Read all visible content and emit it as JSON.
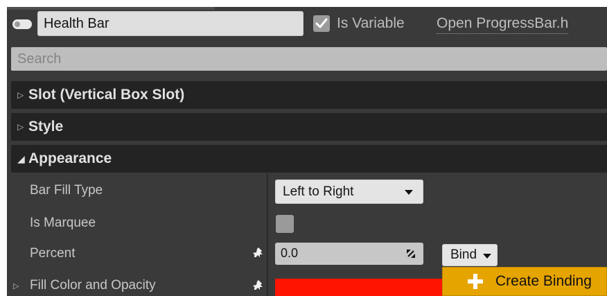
{
  "header": {
    "widget_name": "Health Bar",
    "is_variable_label": "Is Variable",
    "is_variable_checked": true,
    "open_source_link": "Open ProgressBar.h"
  },
  "search": {
    "placeholder": "Search",
    "value": ""
  },
  "categories": [
    {
      "label": "Slot (Vertical Box Slot)",
      "expanded": false
    },
    {
      "label": "Style",
      "expanded": false
    },
    {
      "label": "Appearance",
      "expanded": true
    }
  ],
  "appearance": {
    "bar_fill_type": {
      "label": "Bar Fill Type",
      "value": "Left to Right"
    },
    "is_marquee": {
      "label": "Is Marquee",
      "checked": false
    },
    "percent": {
      "label": "Percent",
      "value": "0.0",
      "bind_label": "Bind"
    },
    "fill_color": {
      "label": "Fill Color and Opacity",
      "color": "#ff1400"
    }
  },
  "bind_menu": {
    "create_binding_label": "Create Binding",
    "accent": "#e6a400"
  },
  "icons": [
    "widget-toggle-icon",
    "checkmark-icon",
    "expand-arrow-icon",
    "collapse-arrow-icon",
    "binding-pin-icon",
    "resize-icon",
    "dropdown-caret-icon",
    "plus-icon"
  ],
  "colors": {
    "panel": "#3a3a3a",
    "category_bg": "#232323",
    "accent": "#e6a400",
    "fill_color": "#ff1400"
  }
}
